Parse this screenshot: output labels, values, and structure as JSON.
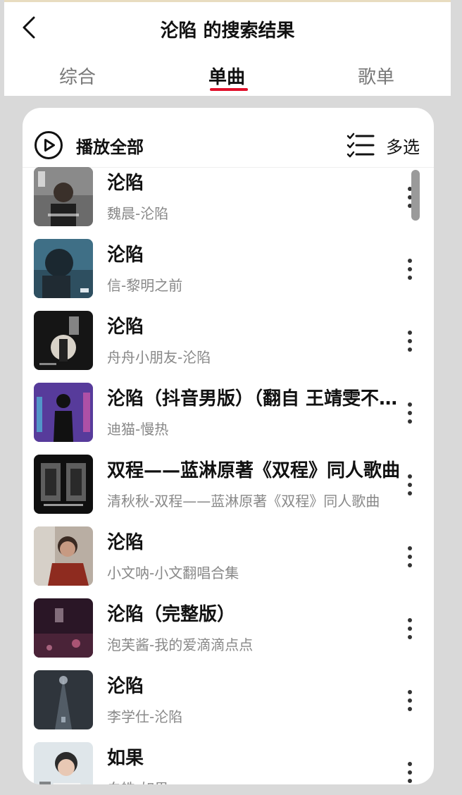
{
  "header": {
    "title": "沦陷 的搜索结果",
    "back_icon": "chevron-left-icon"
  },
  "tabs": [
    {
      "label": "综合",
      "active": false
    },
    {
      "label": "单曲",
      "active": true
    },
    {
      "label": "歌单",
      "active": false
    }
  ],
  "colors": {
    "accent": "#e0102a",
    "background": "#d9d9d9",
    "card": "#ffffff"
  },
  "toolbar": {
    "play_all_label": "播放全部",
    "play_icon": "play-circle-icon",
    "multi_select_label": "多选",
    "multi_select_icon": "checklist-icon"
  },
  "songs": [
    {
      "title": "沦陷",
      "subtitle": "魏晨-沦陷"
    },
    {
      "title": "沦陷",
      "subtitle": "信-黎明之前"
    },
    {
      "title": "沦陷",
      "subtitle": "舟舟小朋友-沦陷"
    },
    {
      "title": "沦陷（抖音男版）（翻自 王靖雯不胖）",
      "subtitle": "迪猫-慢热"
    },
    {
      "title": "双程——蓝淋原著《双程》同人歌曲",
      "subtitle": "清秋秋-双程——蓝淋原著《双程》同人歌曲"
    },
    {
      "title": "沦陷",
      "subtitle": "小文呐-小文翻唱合集"
    },
    {
      "title": "沦陷（完整版）",
      "subtitle": "泡芙酱-我的爱滴滴点点"
    },
    {
      "title": "沦陷",
      "subtitle": "李学仕-沦陷"
    },
    {
      "title": "如果",
      "subtitle": "白皓-如果"
    }
  ]
}
